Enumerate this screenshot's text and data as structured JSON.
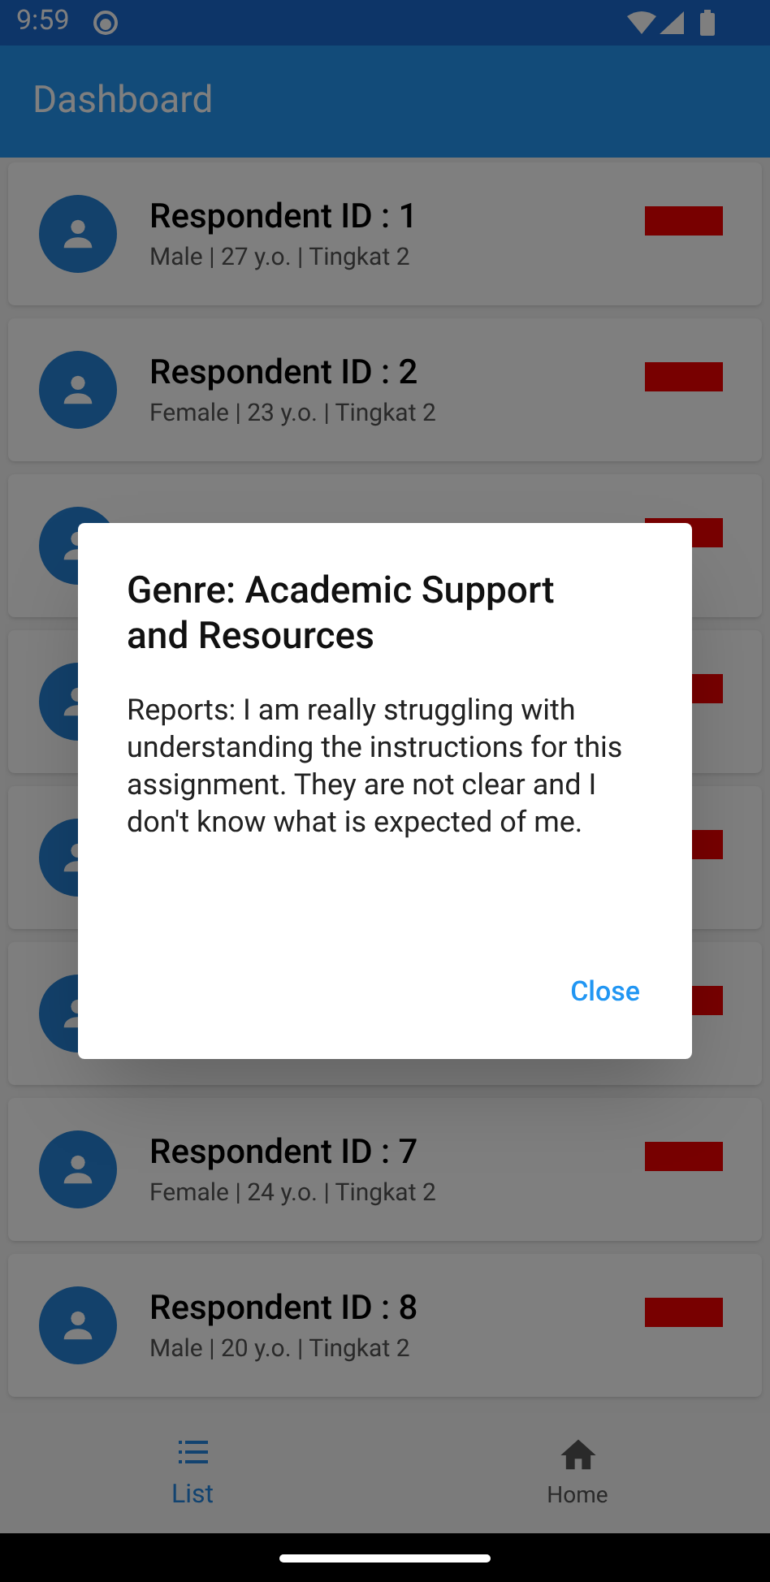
{
  "status_bar": {
    "time": "9:59"
  },
  "app_bar": {
    "title": "Dashboard"
  },
  "respondents": [
    {
      "kind": "respondent",
      "title": "Respondent ID : 1",
      "subtitle": "Male | 27 y.o. | Tingkat 2"
    },
    {
      "kind": "respondent",
      "title": "Respondent ID : 2",
      "subtitle": "Female | 23 y.o. | Tingkat 2"
    },
    {
      "kind": "covered"
    },
    {
      "kind": "covered"
    },
    {
      "kind": "covered"
    },
    {
      "kind": "covered"
    },
    {
      "kind": "respondent",
      "title": "Respondent ID : 7",
      "subtitle": "Female | 24 y.o. | Tingkat 2"
    },
    {
      "kind": "respondent",
      "title": "Respondent ID : 8",
      "subtitle": "Male | 20 y.o. | Tingkat 2"
    }
  ],
  "bottom_nav": [
    {
      "label": "List",
      "kind": "list",
      "selected": true
    },
    {
      "label": "Home",
      "kind": "home",
      "selected": false
    }
  ],
  "dialog": {
    "title": "Genre: Academic Support and Resources",
    "body": "Reports: I am really struggling with understanding the instructions for this assignment. They are not clear and I don't know what is expected of me.",
    "button": "Close"
  }
}
